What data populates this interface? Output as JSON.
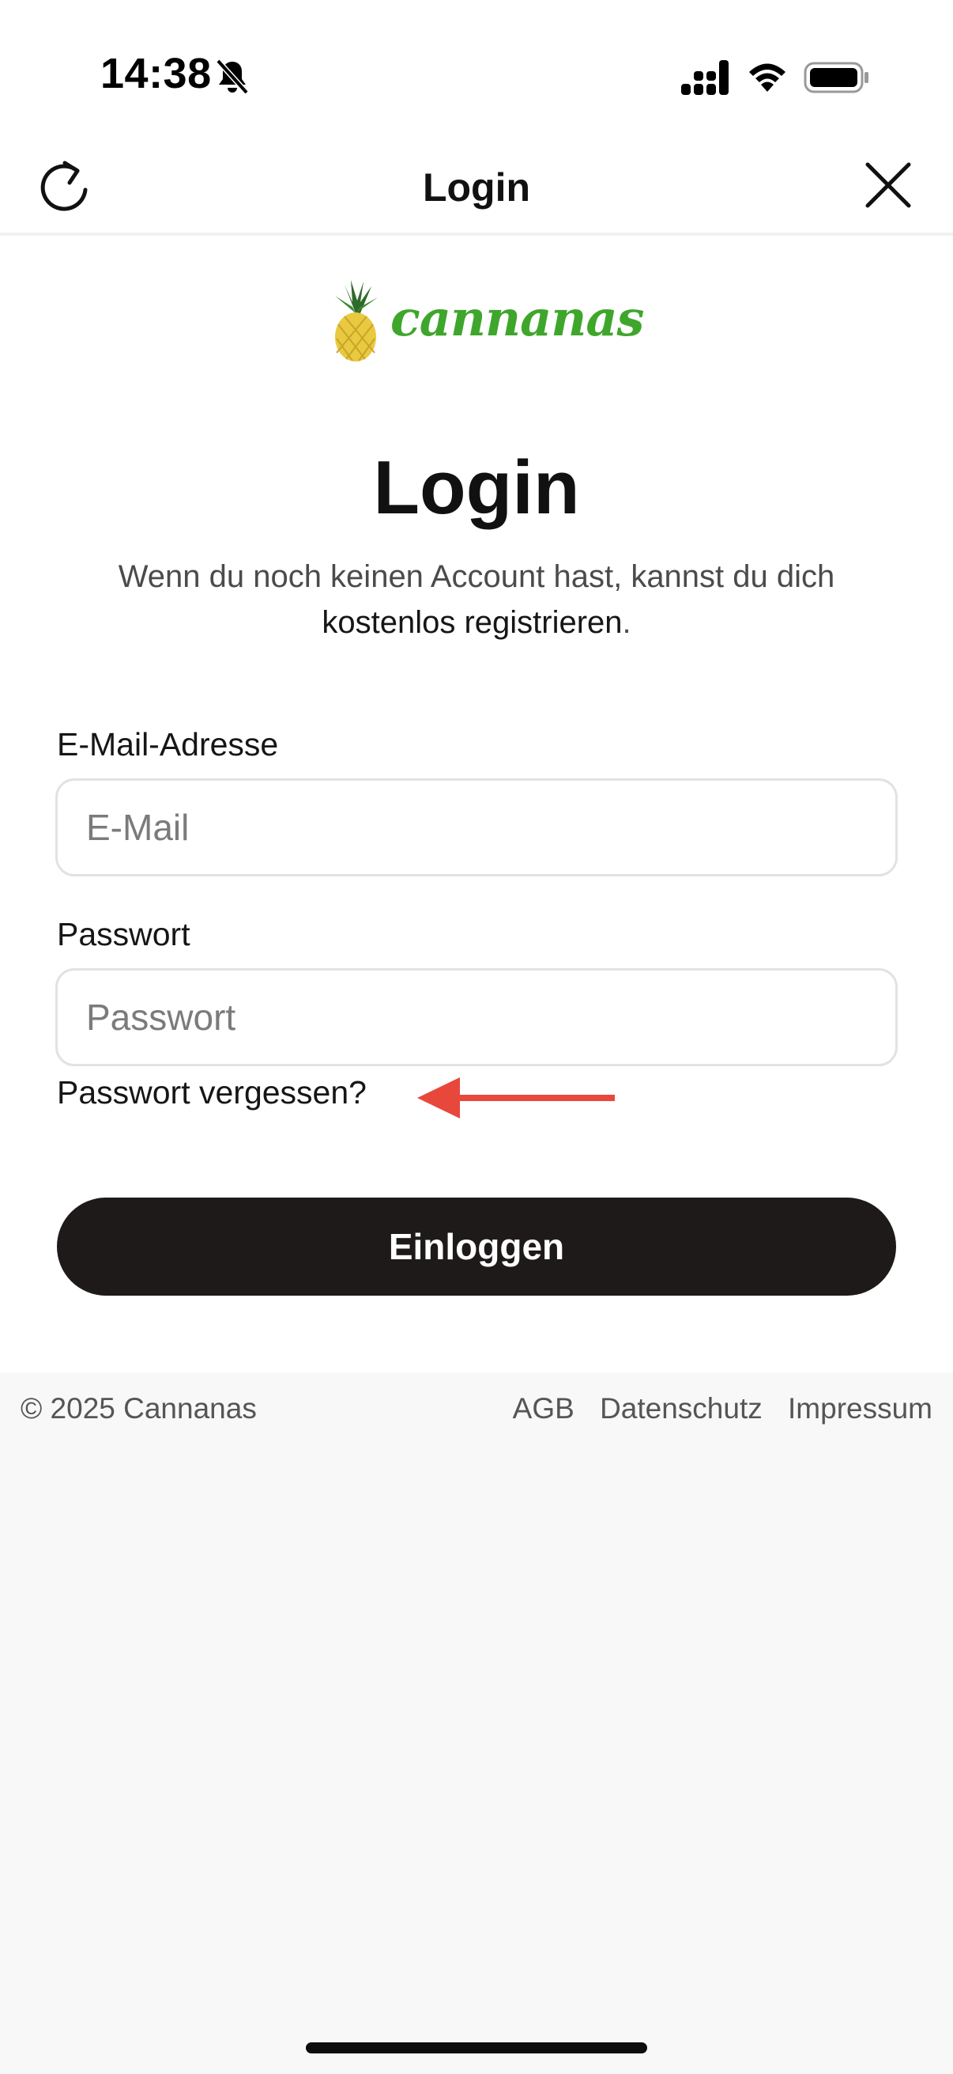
{
  "status_bar": {
    "time": "14:38"
  },
  "nav": {
    "title": "Login"
  },
  "logo": {
    "text": "cannanas"
  },
  "main": {
    "title": "Login",
    "intro_text": "Wenn du noch keinen Account hast, kannst du dich",
    "register_link": "kostenlos registrieren",
    "intro_end": "."
  },
  "form": {
    "email_label": "E-Mail-Adresse",
    "email_placeholder": "E-Mail",
    "email_value": "",
    "password_label": "Passwort",
    "password_placeholder": "Passwort",
    "password_value": "",
    "forgot_link": "Passwort vergessen?",
    "submit_label": "Einloggen"
  },
  "footer": {
    "copyright": "© 2025 Cannanas",
    "links": [
      "AGB",
      "Datenschutz",
      "Impressum"
    ]
  },
  "colors": {
    "brand_green": "#3fa62c",
    "pineapple_yellow": "#e9c93f",
    "button_dark": "#1e1a19",
    "annotation_arrow": "#e8473c"
  }
}
